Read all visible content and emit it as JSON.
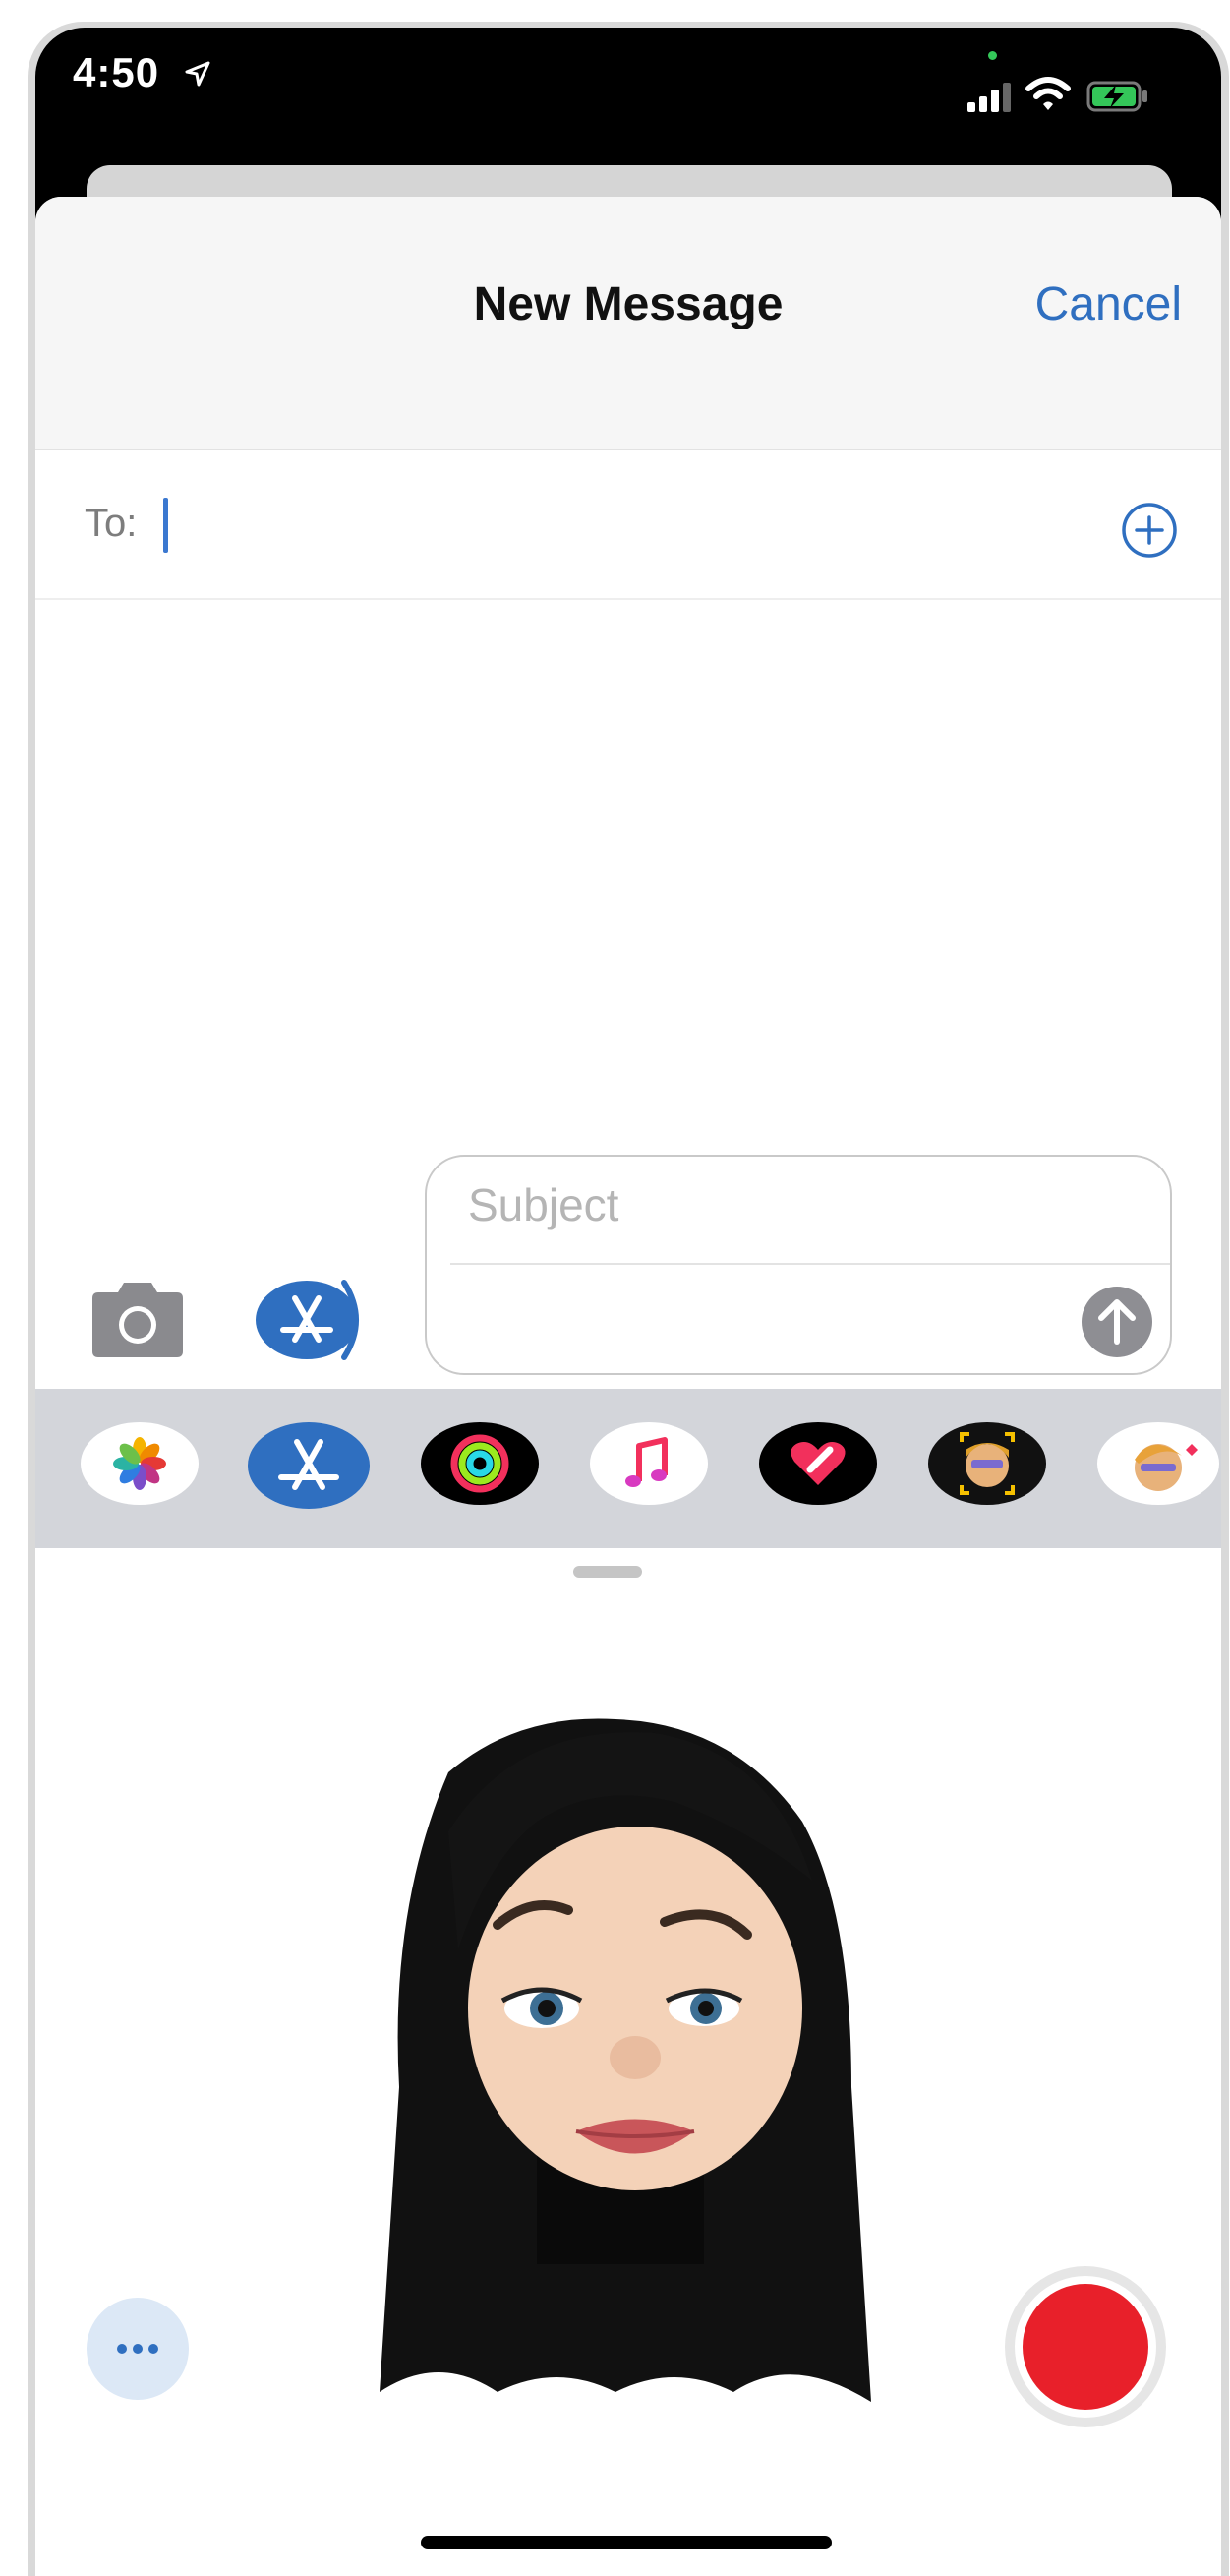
{
  "status_bar": {
    "time": "4:50"
  },
  "navbar": {
    "title": "New Message",
    "cancel_label": "Cancel"
  },
  "recipients": {
    "to_label": "To:"
  },
  "compose": {
    "subject_placeholder": "Subject"
  },
  "app_drawer": {
    "apps": [
      {
        "name": "photos"
      },
      {
        "name": "app-store"
      },
      {
        "name": "activity"
      },
      {
        "name": "music"
      },
      {
        "name": "digital-touch"
      },
      {
        "name": "memoji"
      },
      {
        "name": "memoji-stickers"
      }
    ]
  },
  "colors": {
    "accent": "#2f6fc0",
    "record": "#e8202a",
    "send": "#8e8e93"
  }
}
